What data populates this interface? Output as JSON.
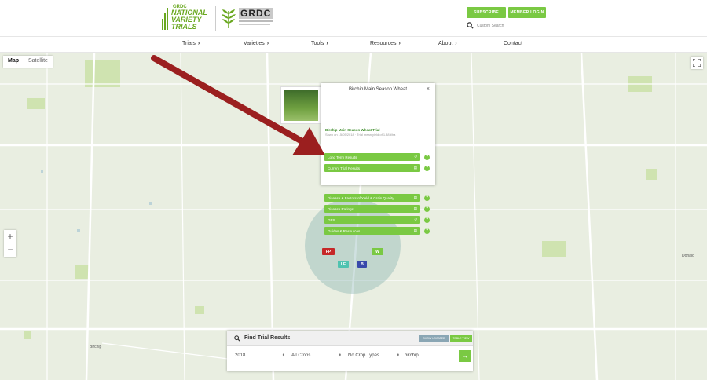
{
  "header": {
    "logo_nvt": {
      "grdc_small": "GRDC",
      "line1": "NATIONAL",
      "line2": "VARIETY",
      "line3": "TRIALS"
    },
    "logo_grdc": "GRDC",
    "subscribe_label": "SUBSCRIBE",
    "member_login_label": "MEMBER LOGIN",
    "search_placeholder": "Custom Search"
  },
  "nav": {
    "items": [
      {
        "label": "Trials"
      },
      {
        "label": "Varieties"
      },
      {
        "label": "Tools"
      },
      {
        "label": "Resources"
      },
      {
        "label": "About"
      },
      {
        "label": "Contact"
      }
    ]
  },
  "map": {
    "type_active": "Map",
    "type_other": "Satellite",
    "zoom_in": "+",
    "zoom_out": "−",
    "labels": {
      "birchip": "Birchip",
      "donald": "Donald"
    },
    "arrow_color": "#9b1f1f"
  },
  "popup": {
    "title": "Birchip Main Season Wheat",
    "close": "×",
    "rows": [
      {
        "label": "Long Term Results"
      },
      {
        "label": "Current Trial Results"
      },
      {
        "label": "Disease & Factors of Yield & Grain Quality"
      },
      {
        "label": "Disease Ratings"
      },
      {
        "label": "GPS"
      },
      {
        "label": "Guides & Resources"
      }
    ],
    "trial_name": "Birchip Main Season Wheat Trial",
    "trial_sub": "Sown on 15/05/2018 · Trial mean yield of 1.88 t/ha"
  },
  "markers": [
    {
      "label": "FP",
      "color": "#c62828"
    },
    {
      "label": "W",
      "color": "#7ac943"
    },
    {
      "label": "LE",
      "color": "#4fc3b0"
    },
    {
      "label": "B",
      "color": "#3949ab"
    }
  ],
  "find": {
    "title": "Find Trial Results",
    "btn_show_located": "SHOW LOCATED",
    "btn_table_view": "TABLE VIEW",
    "year": "2018",
    "crops": "All Crops",
    "crop_types": "No Crop Types",
    "location": "birchip",
    "go": "→"
  },
  "colors": {
    "accent": "#7ac943",
    "map_bg": "#e9eee1"
  }
}
